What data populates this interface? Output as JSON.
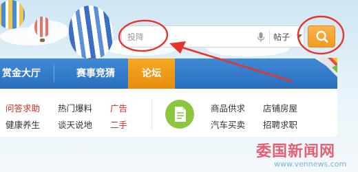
{
  "search": {
    "placeholder": "投降",
    "scope_value": "帖子"
  },
  "nav": {
    "items": [
      {
        "label": "赏金大厅"
      },
      {
        "label": "赛事竞猜"
      },
      {
        "label": "论坛"
      }
    ],
    "active_index": 2
  },
  "links": {
    "left": [
      {
        "label": "问答求助",
        "color": "red"
      },
      {
        "label": "热门爆料",
        "color": "default"
      },
      {
        "label": "广告",
        "color": "red"
      },
      {
        "label": "健康养生",
        "color": "default"
      },
      {
        "label": "谈天说地",
        "color": "default"
      },
      {
        "label": "二手",
        "color": "red"
      }
    ],
    "right": [
      {
        "label": "商品供求"
      },
      {
        "label": "店铺房屋"
      },
      {
        "label": "汽车买卖"
      },
      {
        "label": "招聘求职"
      }
    ]
  },
  "watermark": {
    "name": "委国新闻网",
    "url": "www.vennews.com"
  },
  "colors": {
    "nav_blue": "#2a6fbe",
    "accent_orange": "#f29a1e",
    "link_red": "#d72b23",
    "annotation_red": "#e8332b",
    "doc_icon_green": "#8cc63f"
  },
  "icons": {
    "mic": "microphone-icon",
    "search": "magnifier-icon",
    "doc": "document-icon",
    "dropdown": "caret-down-icon"
  }
}
